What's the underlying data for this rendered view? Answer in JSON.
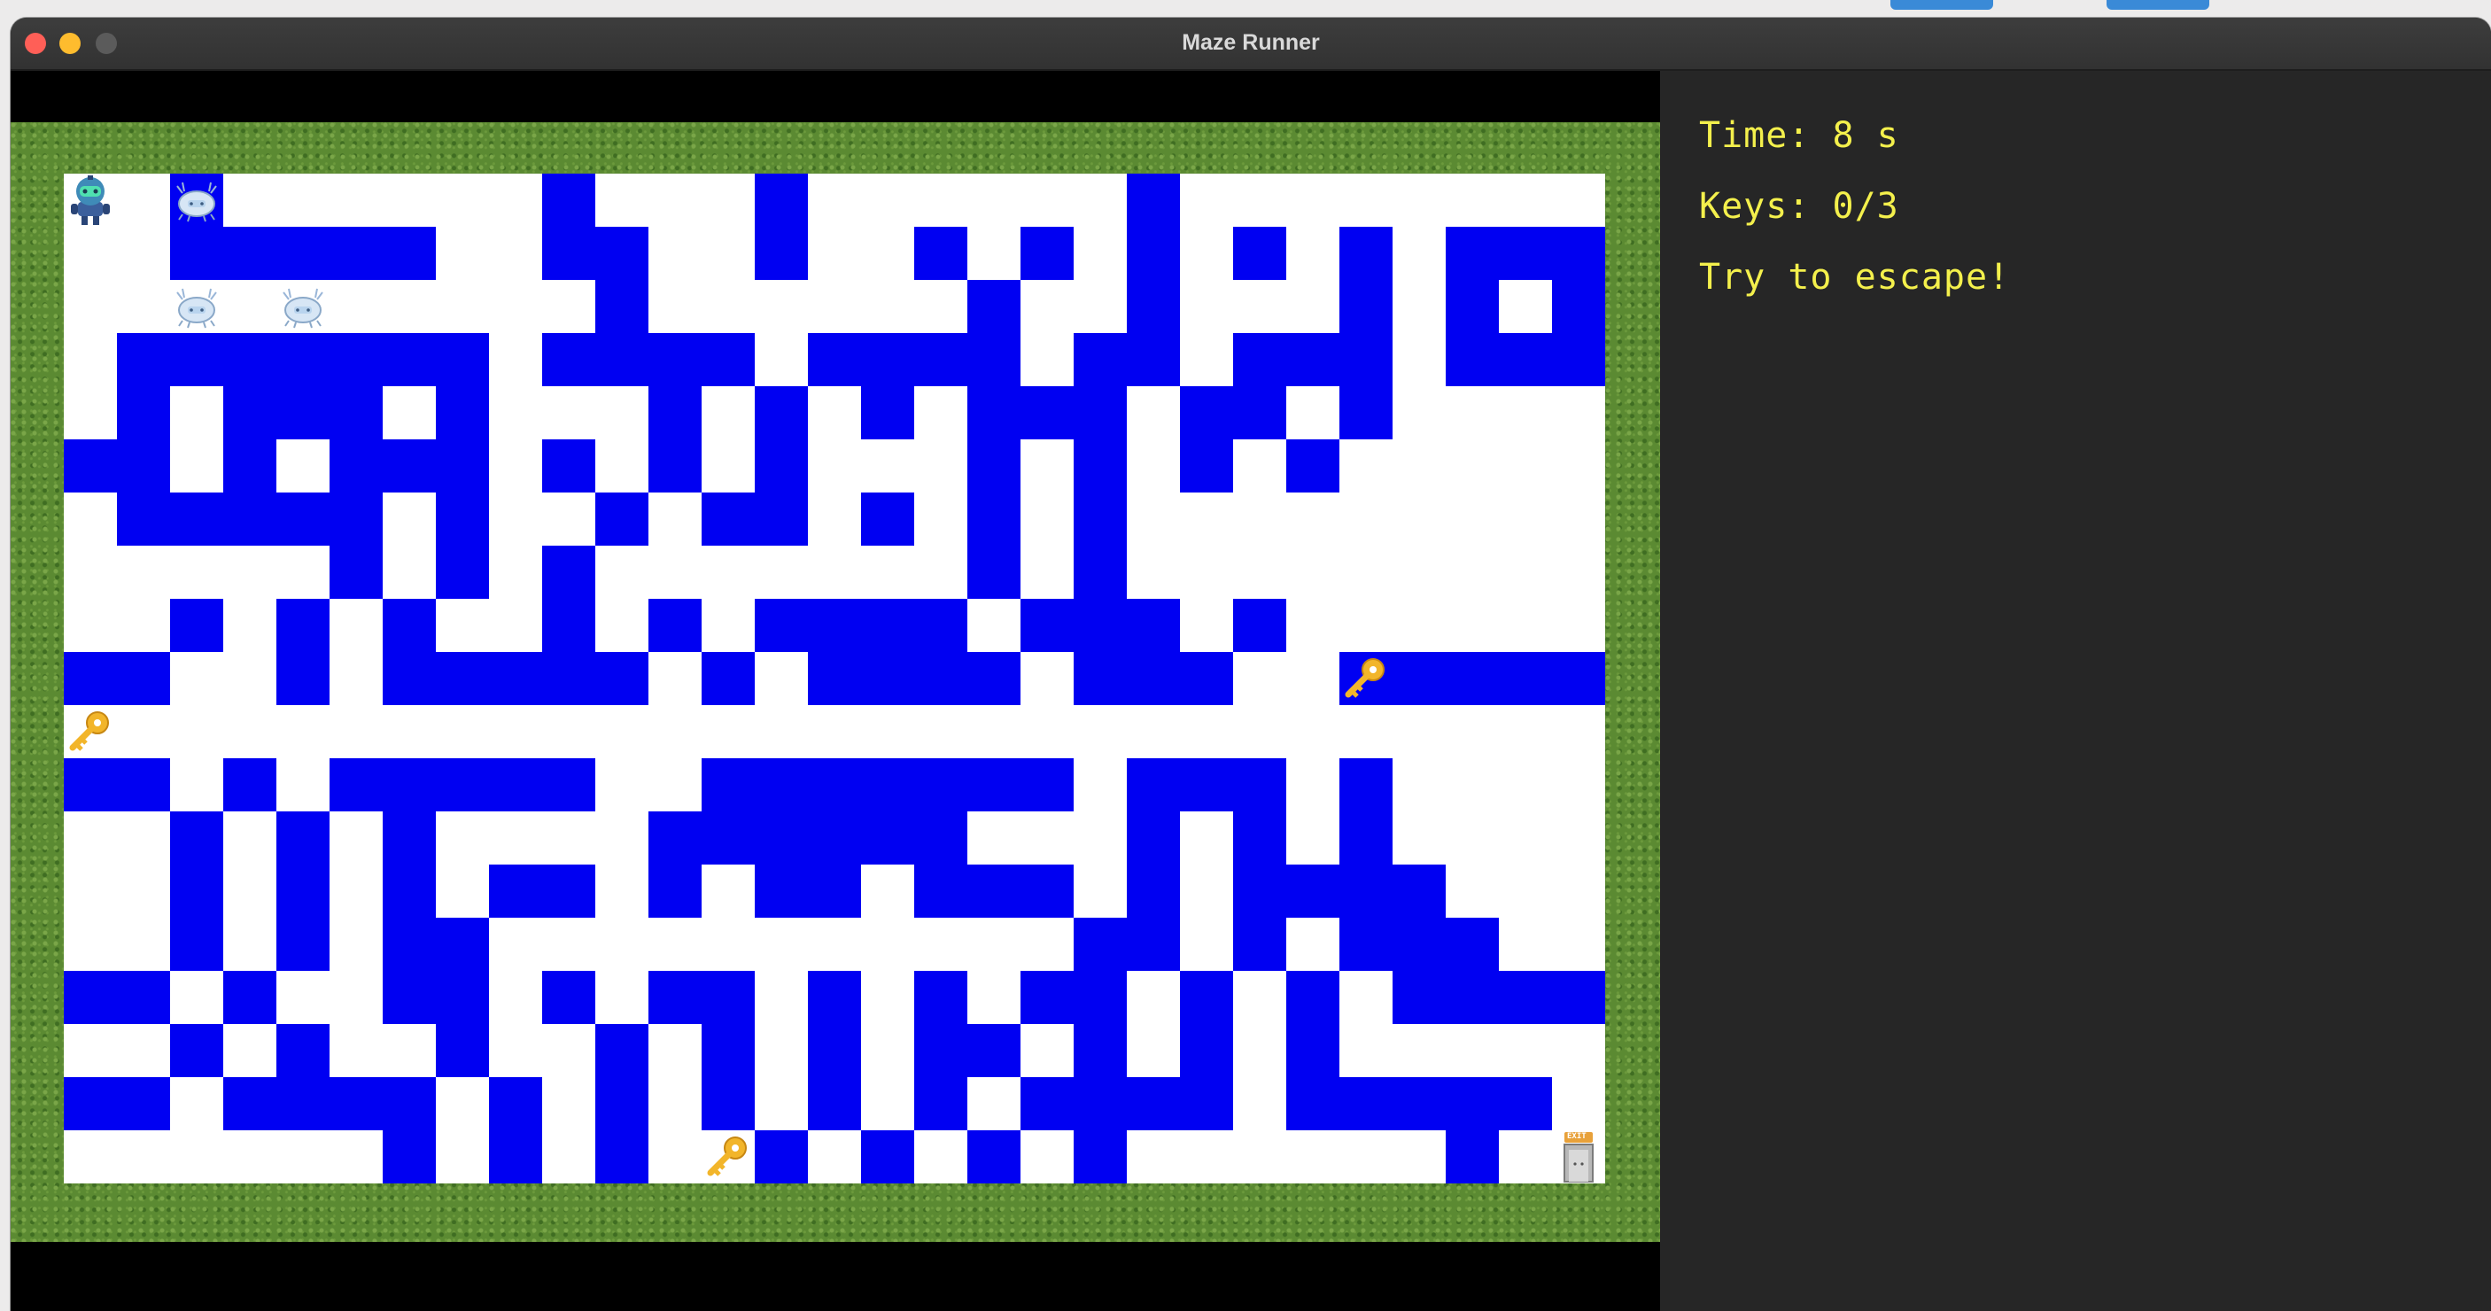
{
  "window": {
    "title": "Maze Runner"
  },
  "hud": {
    "time_label": "Time: 8 s",
    "keys_label": "Keys: 0/3",
    "message": "Try to escape!"
  },
  "colors": {
    "wall": "#0000f2",
    "floor": "#ffffff",
    "grass": "#5b8a32",
    "hud_text": "#f4f04c",
    "panel": "#262626"
  },
  "maze": {
    "columns": 29,
    "rows": 19,
    "walls": [
      "..#......#...#......#...................",
      "..#####..##..#..#.#.#.#.#.####...",
      "..........#......#..#...#.#.#...#...",
      ".#######.####.####.##.###.####...",
      ".#.###.#...#.#.#.###.##.#",
      "##.#.###.#.#.#...#.#.#.#",
      ".#####.#..#.##.#.#.#",
      ".....#.#.#.......#.#",
      "..#.#.#..#.#.####.###.#..",
      "##..#.#####.#.####.###..#####....",
      "......................................",
      "##.#.#####..#######.###.#..",
      "..#.#.#....######...#.#.#",
      "..#.#.#.##.#.##.###.#.####",
      "..#.#.##...........##.#.###",
      "##.#..##.#.##.#.#.##.#.#.####",
      "..#.#..#..#.#.#.##.#.#.#",
      "##.####.#.#.#.#.#.####.#####.",
      "......#.#.#..#.#.#.#......#."
    ]
  },
  "entities": [
    {
      "kind": "player",
      "icon": "robot-icon",
      "col": 0,
      "row": 0
    },
    {
      "kind": "enemy",
      "icon": "ghost-crab-icon",
      "col": 2,
      "row": 0
    },
    {
      "kind": "enemy",
      "icon": "ghost-crab-icon",
      "col": 2,
      "row": 2
    },
    {
      "kind": "enemy",
      "icon": "ghost-crab-icon",
      "col": 4,
      "row": 2
    },
    {
      "kind": "key",
      "icon": "key-icon",
      "col": 0,
      "row": 10
    },
    {
      "kind": "key",
      "icon": "key-icon",
      "col": 24,
      "row": 9
    },
    {
      "kind": "key",
      "icon": "key-icon",
      "col": 12,
      "row": 18
    },
    {
      "kind": "exit",
      "icon": "exit-door-icon",
      "col": 28,
      "row": 18,
      "label": "EXIT"
    }
  ]
}
